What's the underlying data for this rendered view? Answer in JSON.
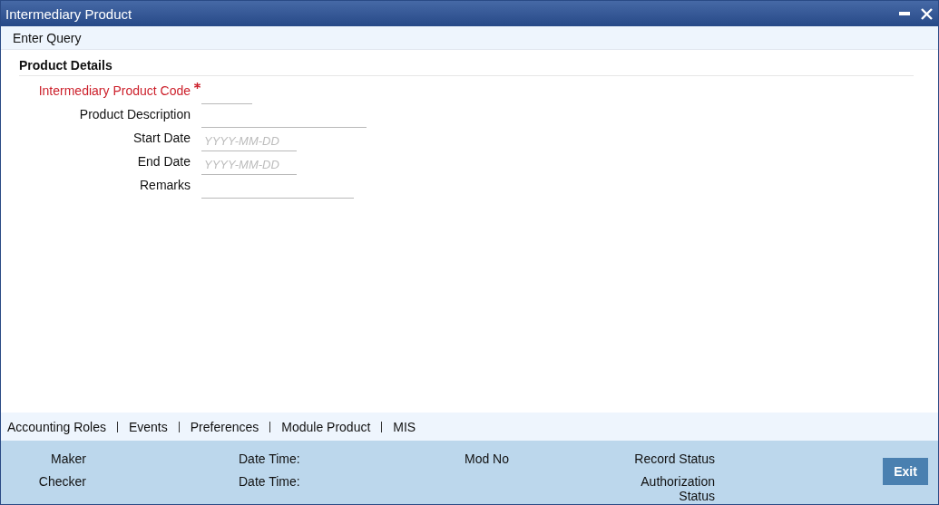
{
  "window": {
    "title": "Intermediary Product"
  },
  "toolbar": {
    "items": [
      "Enter Query"
    ]
  },
  "section": {
    "title": "Product Details"
  },
  "fields": [
    {
      "label": "Intermediary Product Code",
      "required": true
    },
    {
      "label": "Product Description",
      "required": false
    },
    {
      "label": "Start Date",
      "required": false,
      "placeholder": "YYYY-MM-DD"
    },
    {
      "label": "End Date",
      "required": false,
      "placeholder": "YYYY-MM-DD"
    },
    {
      "label": "Remarks",
      "required": false
    }
  ],
  "tabs": [
    "Accounting Roles",
    "Events",
    "Preferences",
    "Module Product",
    "MIS"
  ],
  "audit": {
    "rows": [
      {
        "user_label": "Maker",
        "datetime_label": "Date Time:",
        "mod_label": "Mod No",
        "status_label": "Record Status"
      },
      {
        "user_label": "Checker",
        "datetime_label": "Date Time:",
        "status_label": "Authorization Status"
      }
    ]
  },
  "buttons": [
    "Exit"
  ]
}
